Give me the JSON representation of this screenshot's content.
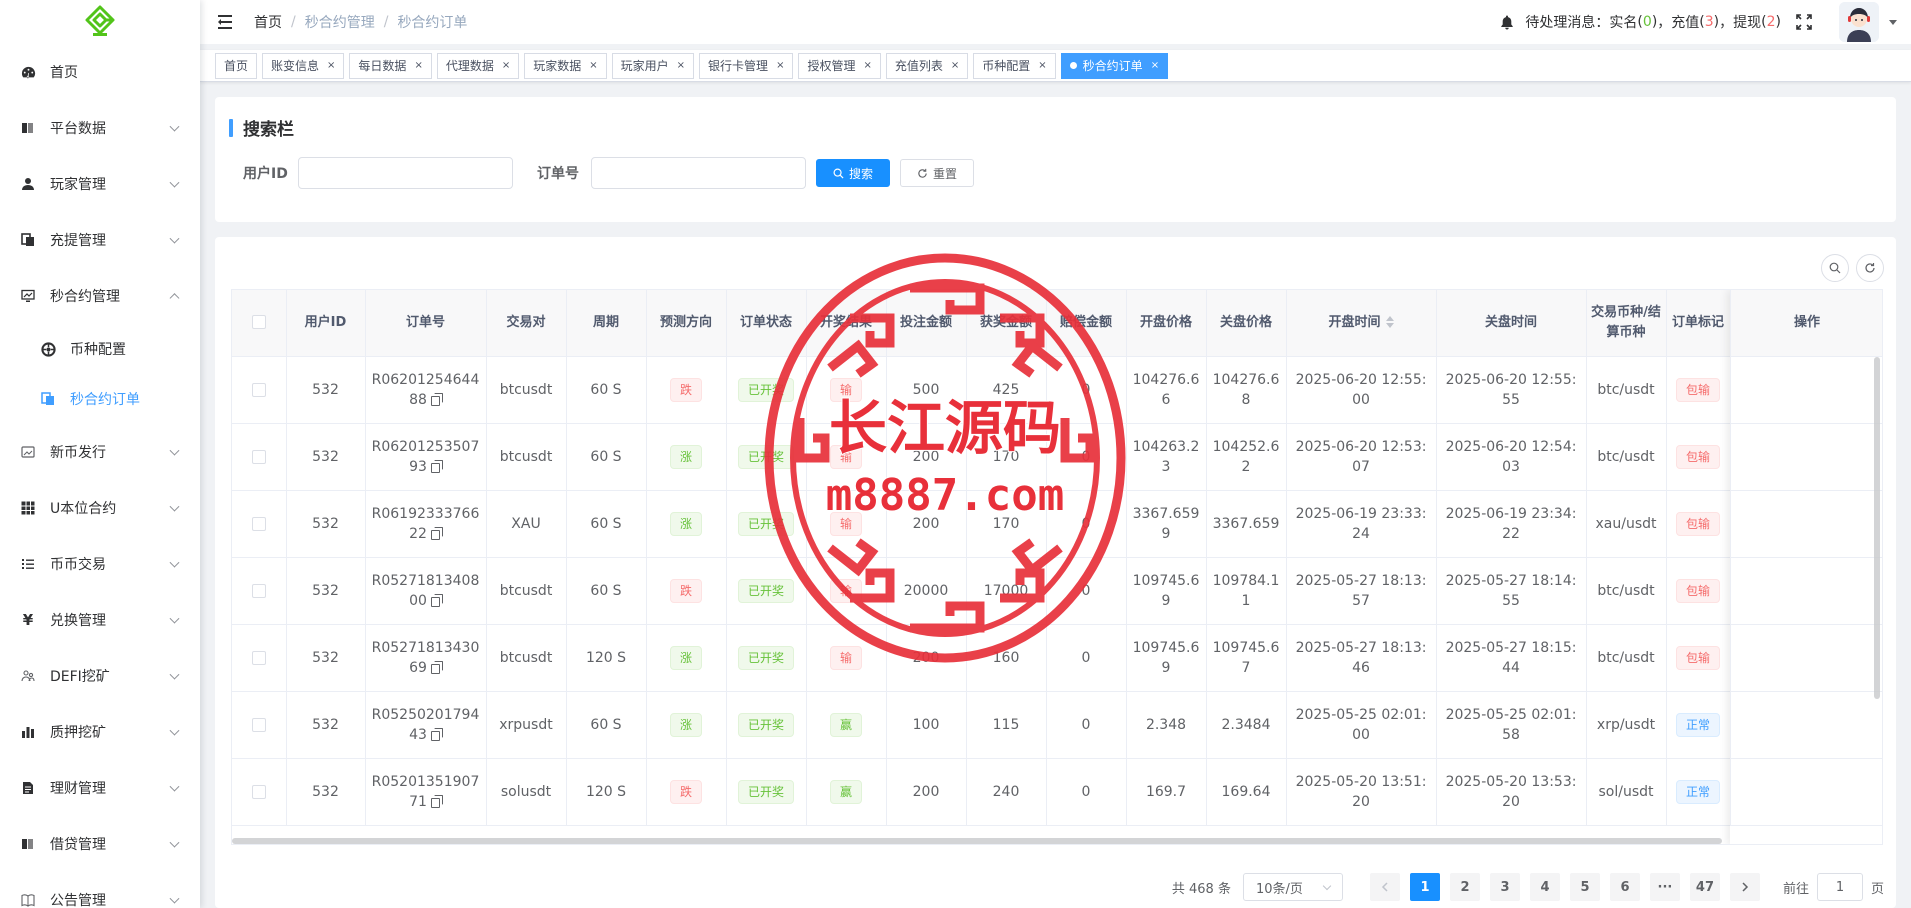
{
  "sidebar": {
    "items": [
      {
        "label": "首页"
      },
      {
        "label": "平台数据"
      },
      {
        "label": "玩家管理"
      },
      {
        "label": "充提管理"
      },
      {
        "label": "秒合约管理"
      },
      {
        "label": "新币发行"
      },
      {
        "label": "U本位合约"
      },
      {
        "label": "币币交易"
      },
      {
        "label": "兑换管理"
      },
      {
        "label": "DEFI挖矿"
      },
      {
        "label": "质押挖矿"
      },
      {
        "label": "理财管理"
      },
      {
        "label": "借贷管理"
      },
      {
        "label": "公告管理"
      }
    ],
    "subitems": [
      {
        "label": "币种配置"
      },
      {
        "label": "秒合约订单"
      }
    ],
    "accent": "#409eff"
  },
  "header": {
    "breadcrumb": [
      "首页",
      "秒合约管理",
      "秒合约订单"
    ],
    "notice_prefix": "待处理消息：",
    "notice_realname": "实名",
    "notice_realname_count": "0",
    "notice_recharge": "充值",
    "notice_recharge_count": "3",
    "notice_withdraw": "提现",
    "notice_withdraw_count": "2"
  },
  "tags": [
    {
      "label": "首页",
      "closable": false
    },
    {
      "label": "账变信息",
      "closable": true
    },
    {
      "label": "每日数据",
      "closable": true
    },
    {
      "label": "代理数据",
      "closable": true
    },
    {
      "label": "玩家数据",
      "closable": true
    },
    {
      "label": "玩家用户",
      "closable": true
    },
    {
      "label": "银行卡管理",
      "closable": true
    },
    {
      "label": "授权管理",
      "closable": true
    },
    {
      "label": "充值列表",
      "closable": true
    },
    {
      "label": "币种配置",
      "closable": true
    },
    {
      "label": "秒合约订单",
      "closable": true,
      "active": true
    }
  ],
  "search": {
    "title": "搜索栏",
    "user_id_label": "用户ID",
    "order_no_label": "订单号",
    "search_btn": "搜索",
    "reset_btn": "重置"
  },
  "table": {
    "columns": [
      "用户ID",
      "订单号",
      "交易对",
      "周期",
      "预测方向",
      "订单状态",
      "开奖结果",
      "投注金额",
      "获奖金额",
      "赔偿金额",
      "开盘价格",
      "关盘价格",
      "开盘时间",
      "关盘时间",
      "交易币种/结算币种",
      "订单标记",
      "操作"
    ],
    "rows": [
      {
        "uid": "532",
        "order": "R0620125464488",
        "pair": "btcusdt",
        "period": "60 S",
        "dir": "跌",
        "status": "已开奖",
        "result": "输",
        "bet": "500",
        "win": "425",
        "comp": "0",
        "open": "104276.66",
        "close": "104276.68",
        "otime": "2025-06-20 12:55:00",
        "ctime": "2025-06-20 12:55:55",
        "coin": "btc/usdt",
        "mark": "包输"
      },
      {
        "uid": "532",
        "order": "R0620125350793",
        "pair": "btcusdt",
        "period": "60 S",
        "dir": "涨",
        "status": "已开奖",
        "result": "输",
        "bet": "200",
        "win": "170",
        "comp": "0",
        "open": "104263.23",
        "close": "104252.62",
        "otime": "2025-06-20 12:53:07",
        "ctime": "2025-06-20 12:54:03",
        "coin": "btc/usdt",
        "mark": "包输"
      },
      {
        "uid": "532",
        "order": "R0619233376622",
        "pair": "XAU",
        "period": "60 S",
        "dir": "涨",
        "status": "已开奖",
        "result": "输",
        "bet": "200",
        "win": "170",
        "comp": "0",
        "open": "3367.6599",
        "close": "3367.659",
        "otime": "2025-06-19 23:33:24",
        "ctime": "2025-06-19 23:34:22",
        "coin": "xau/usdt",
        "mark": "包输"
      },
      {
        "uid": "532",
        "order": "R0527181340800",
        "pair": "btcusdt",
        "period": "60 S",
        "dir": "跌",
        "status": "已开奖",
        "result": "输",
        "bet": "20000",
        "win": "17000",
        "comp": "0",
        "open": "109745.69",
        "close": "109784.11",
        "otime": "2025-05-27 18:13:57",
        "ctime": "2025-05-27 18:14:55",
        "coin": "btc/usdt",
        "mark": "包输"
      },
      {
        "uid": "532",
        "order": "R0527181343069",
        "pair": "btcusdt",
        "period": "120 S",
        "dir": "涨",
        "status": "已开奖",
        "result": "输",
        "bet": "200",
        "win": "160",
        "comp": "0",
        "open": "109745.69",
        "close": "109745.67",
        "otime": "2025-05-27 18:13:46",
        "ctime": "2025-05-27 18:15:44",
        "coin": "btc/usdt",
        "mark": "包输"
      },
      {
        "uid": "532",
        "order": "R0525020179443",
        "pair": "xrpusdt",
        "period": "60 S",
        "dir": "涨",
        "status": "已开奖",
        "result": "赢",
        "bet": "100",
        "win": "115",
        "comp": "0",
        "open": "2.348",
        "close": "2.3484",
        "otime": "2025-05-25 02:01:00",
        "ctime": "2025-05-25 02:01:58",
        "coin": "xrp/usdt",
        "mark": "正常"
      },
      {
        "uid": "532",
        "order": "R0520135190771",
        "pair": "solusdt",
        "period": "120 S",
        "dir": "跌",
        "status": "已开奖",
        "result": "赢",
        "bet": "200",
        "win": "240",
        "comp": "0",
        "open": "169.7",
        "close": "169.64",
        "otime": "2025-05-20 13:51:20",
        "ctime": "2025-05-20 13:53:20",
        "coin": "sol/usdt",
        "mark": "正常"
      }
    ]
  },
  "pagination": {
    "total_prefix": "共",
    "total": "468",
    "total_suffix": "条",
    "page_size": "10条/页",
    "pages": [
      "1",
      "2",
      "3",
      "4",
      "5",
      "6",
      "···",
      "47"
    ],
    "current": "1",
    "goto_prefix": "前往",
    "goto_value": "1",
    "goto_suffix": "页"
  },
  "watermark": {
    "line1": "长江源码",
    "line2": "m8887.com",
    "color": "#e8303a"
  },
  "colors": {
    "primary": "#1890ff",
    "red_tag": "#f56c6c",
    "green_tag": "#67c23a",
    "blue_tag": "#409eff"
  }
}
